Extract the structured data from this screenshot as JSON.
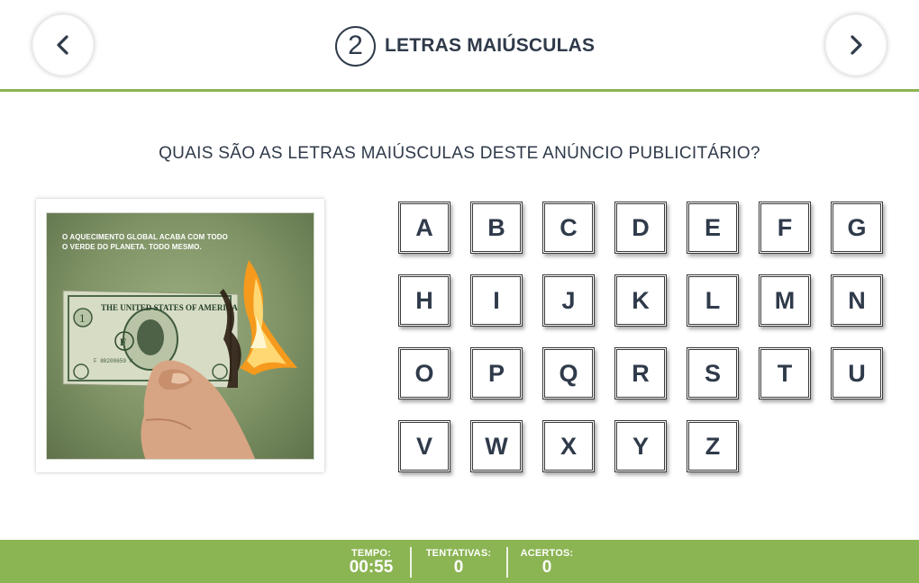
{
  "header": {
    "step_number": "2",
    "title": "LETRAS MAIÚSCULAS",
    "prev_icon": "chevron-left-icon",
    "next_icon": "chevron-right-icon"
  },
  "question": "QUAIS SÃO AS LETRAS MAIÚSCULAS DESTE ANÚNCIO PUBLICITÁRIO?",
  "ad": {
    "line1": "O AQUECIMENTO GLOBAL ACABA COM TODO",
    "line2": "O VERDE DO PLANETA. TODO MESMO.",
    "banknote_text": "THE UNITED STATES OF AMERICA",
    "banknote_serial": "F 88208659 H",
    "banknote_letter": "F",
    "banknote_digit": "1"
  },
  "letters": [
    "A",
    "B",
    "C",
    "D",
    "E",
    "F",
    "G",
    "H",
    "I",
    "J",
    "K",
    "L",
    "M",
    "N",
    "O",
    "P",
    "Q",
    "R",
    "S",
    "T",
    "U",
    "V",
    "W",
    "X",
    "Y",
    "Z"
  ],
  "footer": {
    "time_label": "TEMPO:",
    "time_value": "00:55",
    "attempts_label": "TENTATIVAS:",
    "attempts_value": "0",
    "hits_label": "ACERTOS:",
    "hits_value": "0"
  },
  "colors": {
    "accent_green": "#8bb453",
    "text_dark": "#2f3a4a",
    "photo_background": "#7f9366",
    "flame": "#f59a1c"
  }
}
